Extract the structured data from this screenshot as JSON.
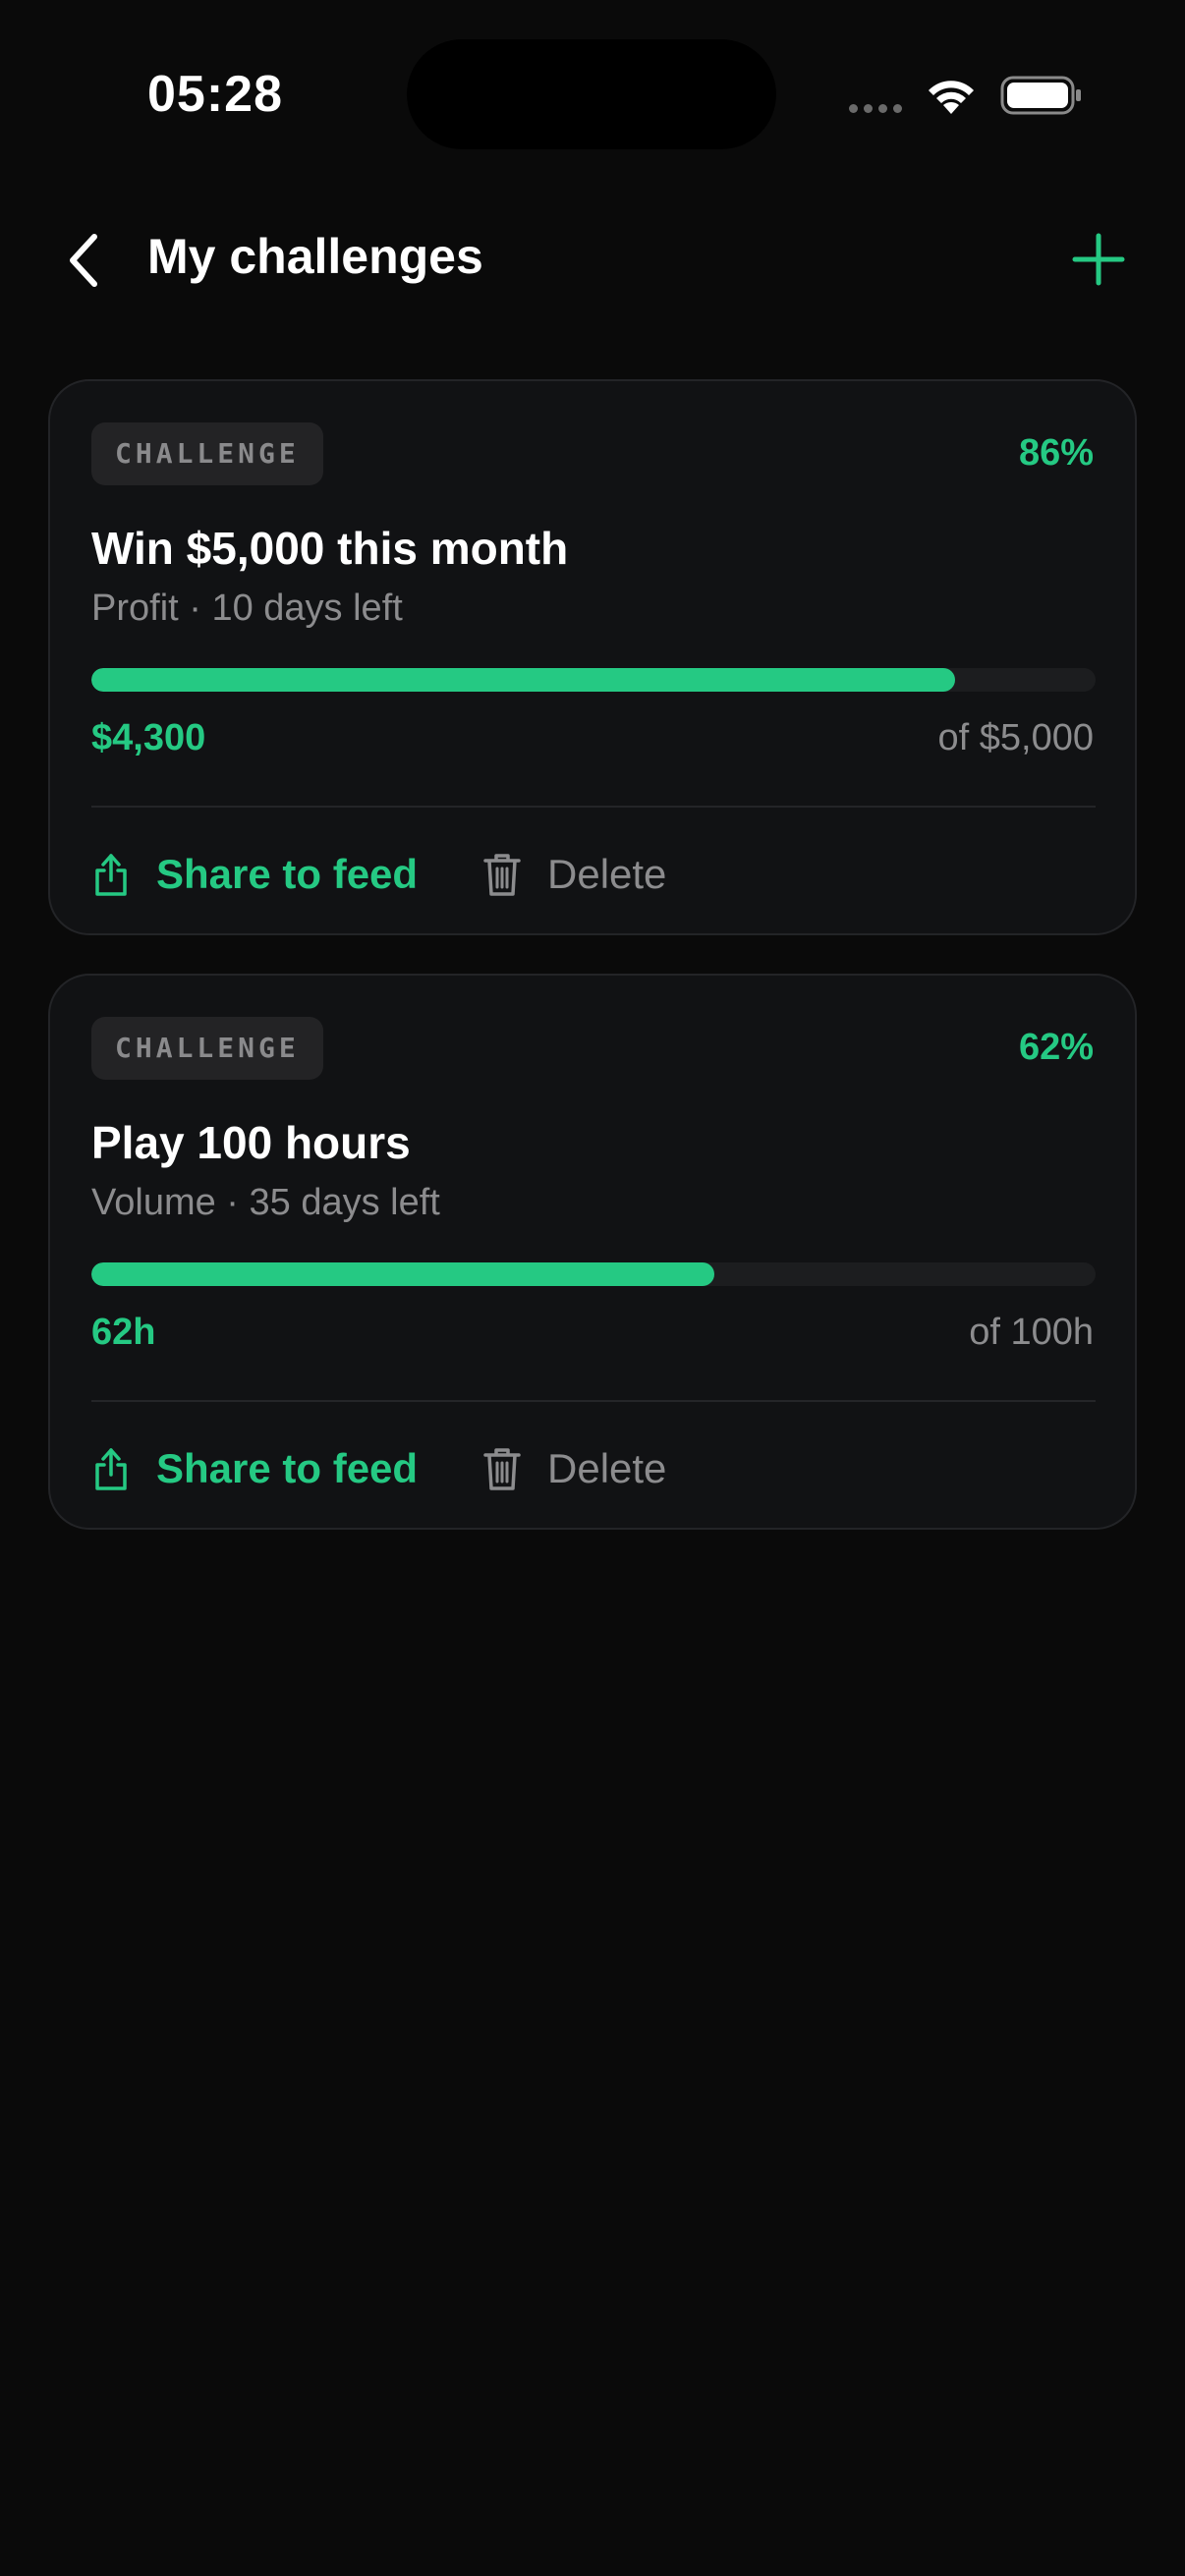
{
  "status_bar": {
    "time": "05:28"
  },
  "header": {
    "title": "My challenges",
    "back_icon": "chevron-left-icon",
    "add_icon": "plus-icon"
  },
  "colors": {
    "accent": "#25c983",
    "background": "#0a0a0a",
    "card": "#111214",
    "muted_text": "#8c8c8e"
  },
  "challenges": [
    {
      "badge": "CHALLENGE",
      "percent_label": "86%",
      "progress": 0.86,
      "title": "Win $5,000 this month",
      "subtitle": "Profit · 10 days left",
      "current_value": "$4,300",
      "target_value": "of $5,000",
      "share_label": "Share to feed",
      "delete_label": "Delete"
    },
    {
      "badge": "CHALLENGE",
      "percent_label": "62%",
      "progress": 0.62,
      "title": "Play 100 hours",
      "subtitle": "Volume · 35 days left",
      "current_value": "62h",
      "target_value": "of 100h",
      "share_label": "Share to feed",
      "delete_label": "Delete"
    }
  ]
}
